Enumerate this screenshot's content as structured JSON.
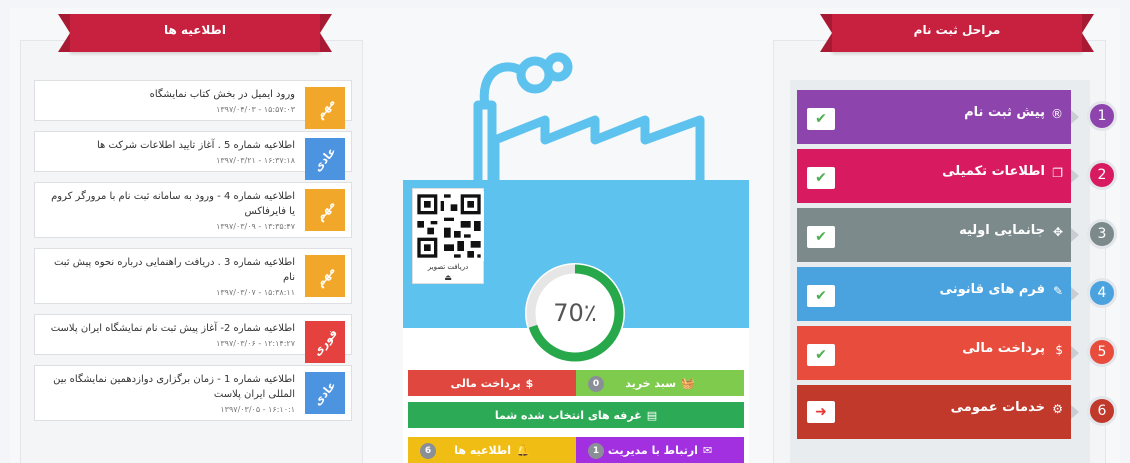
{
  "announcements_title": "اطلاعیه ها",
  "steps_title": "مراحل ثبت نام",
  "announcements": [
    {
      "title": "ورود ایمیل در بخش کتاب نمایشگاه",
      "date": "۱۳۹۷/۰۴/۰۳ - ۱۵:۵۷:۰۳",
      "badge": "مهم",
      "badge_color": "#f1a82a"
    },
    {
      "title": "اطلاعیه شماره 5 . آغاز تایید اطلاعات شرکت ها",
      "date": "۱۳۹۷/۰۳/۲۱ - ۱۶:۳۷:۱۸",
      "badge": "عادی",
      "badge_color": "#4d94e0"
    },
    {
      "title": "اطلاعیه شماره 4 - ورود به سامانه ثبت نام با مرورگر کروم یا فایرفاکس",
      "date": "۱۳۹۷/۰۳/۰۹ - ۱۳:۳۵:۴۷",
      "badge": "مهم",
      "badge_color": "#f1a82a"
    },
    {
      "title": "اطلاعیه شماره 3 . دریافت راهنمایی درباره نحوه پیش ثبت نام",
      "date": "۱۳۹۷/۰۳/۰۷ - ۱۵:۳۸:۱۱",
      "badge": "مهم",
      "badge_color": "#f1a82a"
    },
    {
      "title": "اطلاعیه شماره 2- آغاز پیش ثبت نام نمایشگاه ایران پلاست",
      "date": "۱۳۹۷/۰۳/۰۶ - ۱۲:۱۴:۲۷",
      "badge": "فوری",
      "badge_color": "#e5413f"
    },
    {
      "title": "اطلاعیه شماره 1 - زمان برگزاری دوازدهمین نمایشگاه بین المللی ایران پلاست",
      "date": "۱۳۹۷/۰۳/۰۵ - ۱۶:۱۰:۱",
      "badge": "عادی",
      "badge_color": "#4d94e0"
    }
  ],
  "center": {
    "qr_label": "دریافت تصویر",
    "progress_text": "70٪",
    "progress_value": 70,
    "buttons": {
      "payment": "پرداخت مالی",
      "cart": "سبد خرید",
      "cart_count": "0",
      "booths": "غرفه های انتخاب شده شما",
      "announcements": "اطلاعیه ها",
      "announcements_count": "6",
      "contact": "ارتباط با مدیریت",
      "contact_count": "1"
    }
  },
  "steps": [
    {
      "num": "1",
      "label": "پیش ثبت نام",
      "icon": "registered-icon",
      "state": "done",
      "color": "#8e44ad"
    },
    {
      "num": "2",
      "label": "اطلاعات تکمیلی",
      "icon": "copy-icon",
      "state": "done",
      "color": "#d81b60"
    },
    {
      "num": "3",
      "label": "جانمایی اولیه",
      "icon": "move-icon",
      "state": "done",
      "color": "#7d8a8b"
    },
    {
      "num": "4",
      "label": "فرم های قانونی",
      "icon": "attach-icon",
      "state": "done",
      "color": "#4aa3df"
    },
    {
      "num": "5",
      "label": "پرداخت مالی",
      "icon": "dollar-icon",
      "state": "done",
      "color": "#e74c3c"
    },
    {
      "num": "6",
      "label": "خدمات عمومی",
      "icon": "cogs-icon",
      "state": "current",
      "color": "#c0392b"
    }
  ]
}
